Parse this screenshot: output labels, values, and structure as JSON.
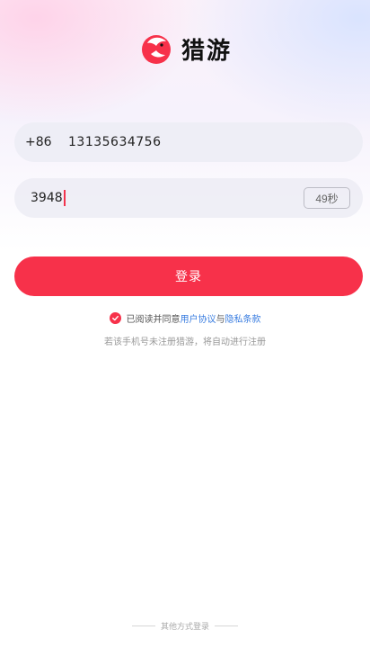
{
  "app": {
    "name": "猎游",
    "brand_color": "#f7314a"
  },
  "phone": {
    "prefix": "+86",
    "number": "13135634756"
  },
  "code": {
    "value": "3948",
    "countdown_label": "49秒"
  },
  "login_button": {
    "label": "登录"
  },
  "agreement": {
    "checked": true,
    "prefix_text": "已阅读并同意",
    "user_agreement": "用户协议",
    "and_text": "与",
    "privacy_policy": "隐私条款",
    "link_color": "#3a7de0"
  },
  "hint": {
    "text": "若该手机号未注册猎游，将自动进行注册"
  },
  "other_login": {
    "label": "其他方式登录"
  }
}
